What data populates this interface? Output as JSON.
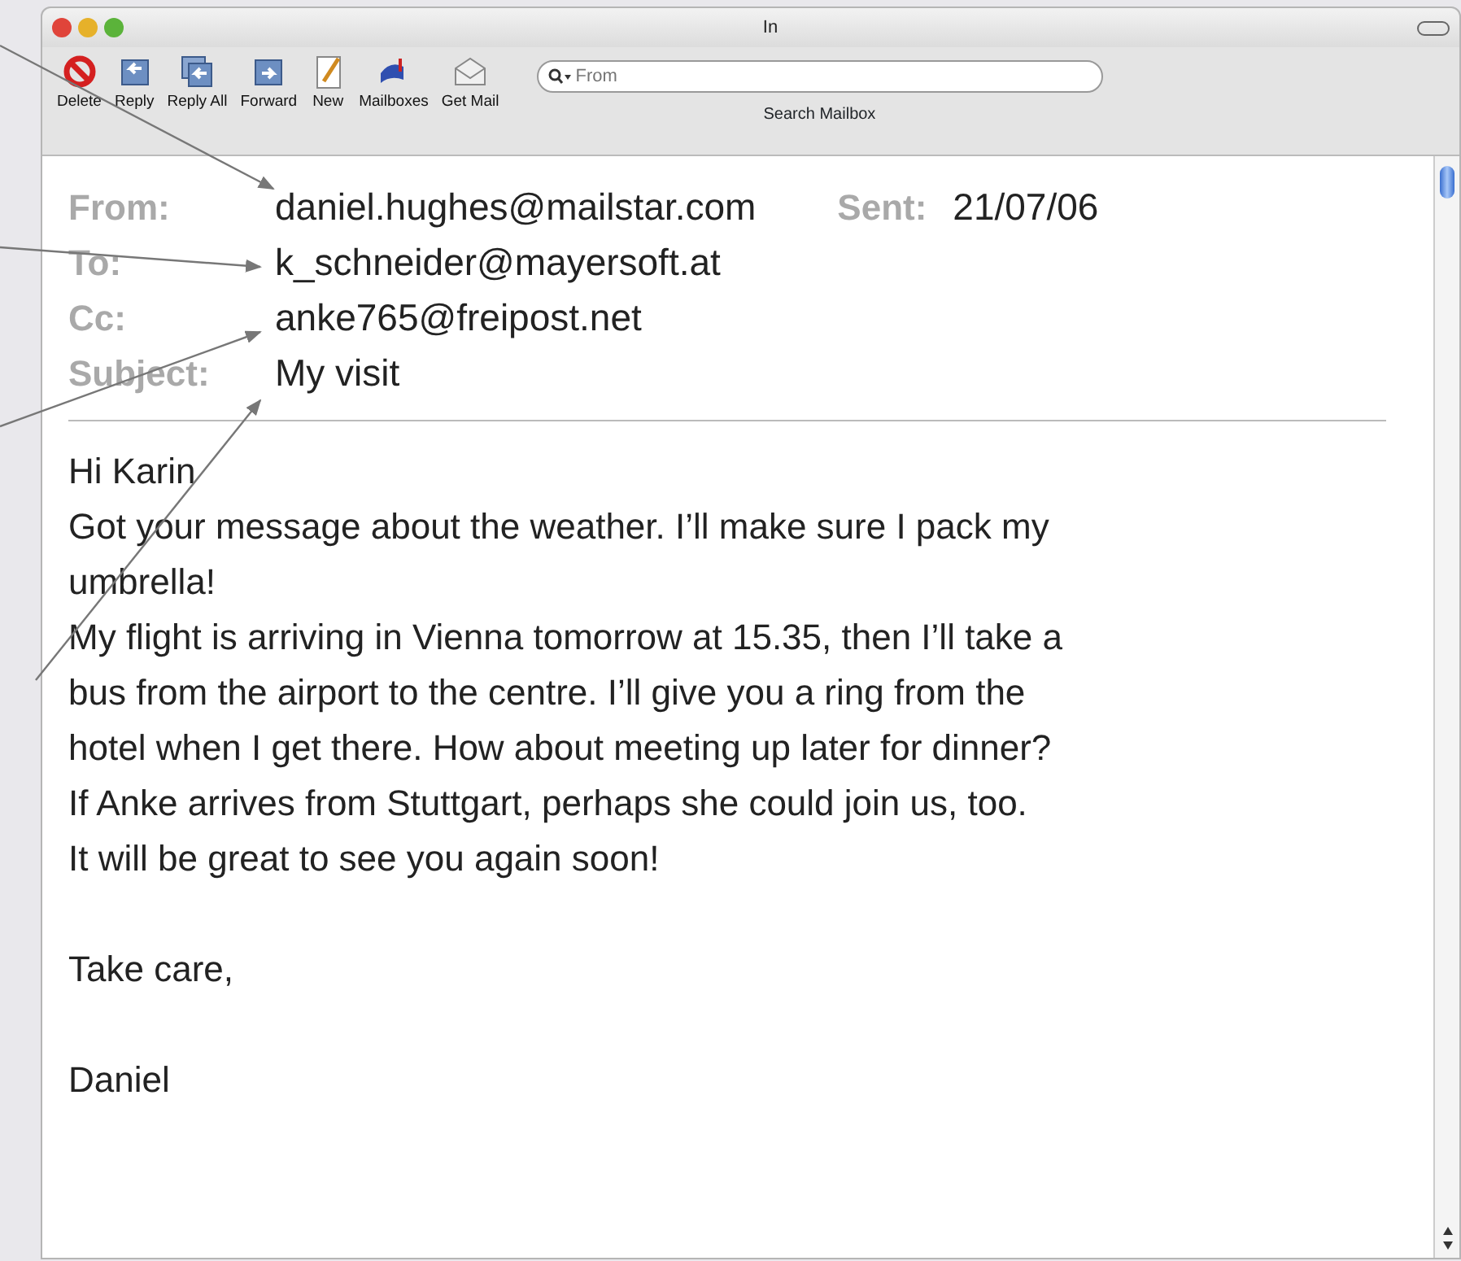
{
  "window": {
    "title": "In"
  },
  "toolbar": {
    "buttons": [
      {
        "label": "Delete"
      },
      {
        "label": "Reply"
      },
      {
        "label": "Reply All"
      },
      {
        "label": "Forward"
      },
      {
        "label": "New"
      },
      {
        "label": "Mailboxes"
      },
      {
        "label": "Get Mail"
      }
    ],
    "search": {
      "placeholder": "From",
      "label": "Search Mailbox"
    }
  },
  "message": {
    "headers": [
      {
        "label": "From:",
        "value": "daniel.hughes@mailstar.com"
      },
      {
        "label": "To:",
        "value": "k_schneider@mayersoft.at"
      },
      {
        "label": "Cc:",
        "value": "anke765@freipost.net"
      },
      {
        "label": "Subject:",
        "value": "My visit"
      }
    ],
    "sent": {
      "label": "Sent:",
      "value": "21/07/06"
    },
    "body": [
      [
        "Hi Karin",
        "Got your message about the weather. I’ll make sure I pack my",
        "umbrella!",
        "My flight is arriving in Vienna tomorrow at 15.35, then I’ll take a",
        "bus from the airport to the centre. I’ll give you a ring from the",
        "hotel when I get there. How about meeting up later for dinner?",
        "If Anke arrives from Stuttgart, perhaps she could join us, too.",
        "It will be great to see you again soon!"
      ],
      [
        "Take care,"
      ],
      [
        "Daniel"
      ]
    ]
  }
}
